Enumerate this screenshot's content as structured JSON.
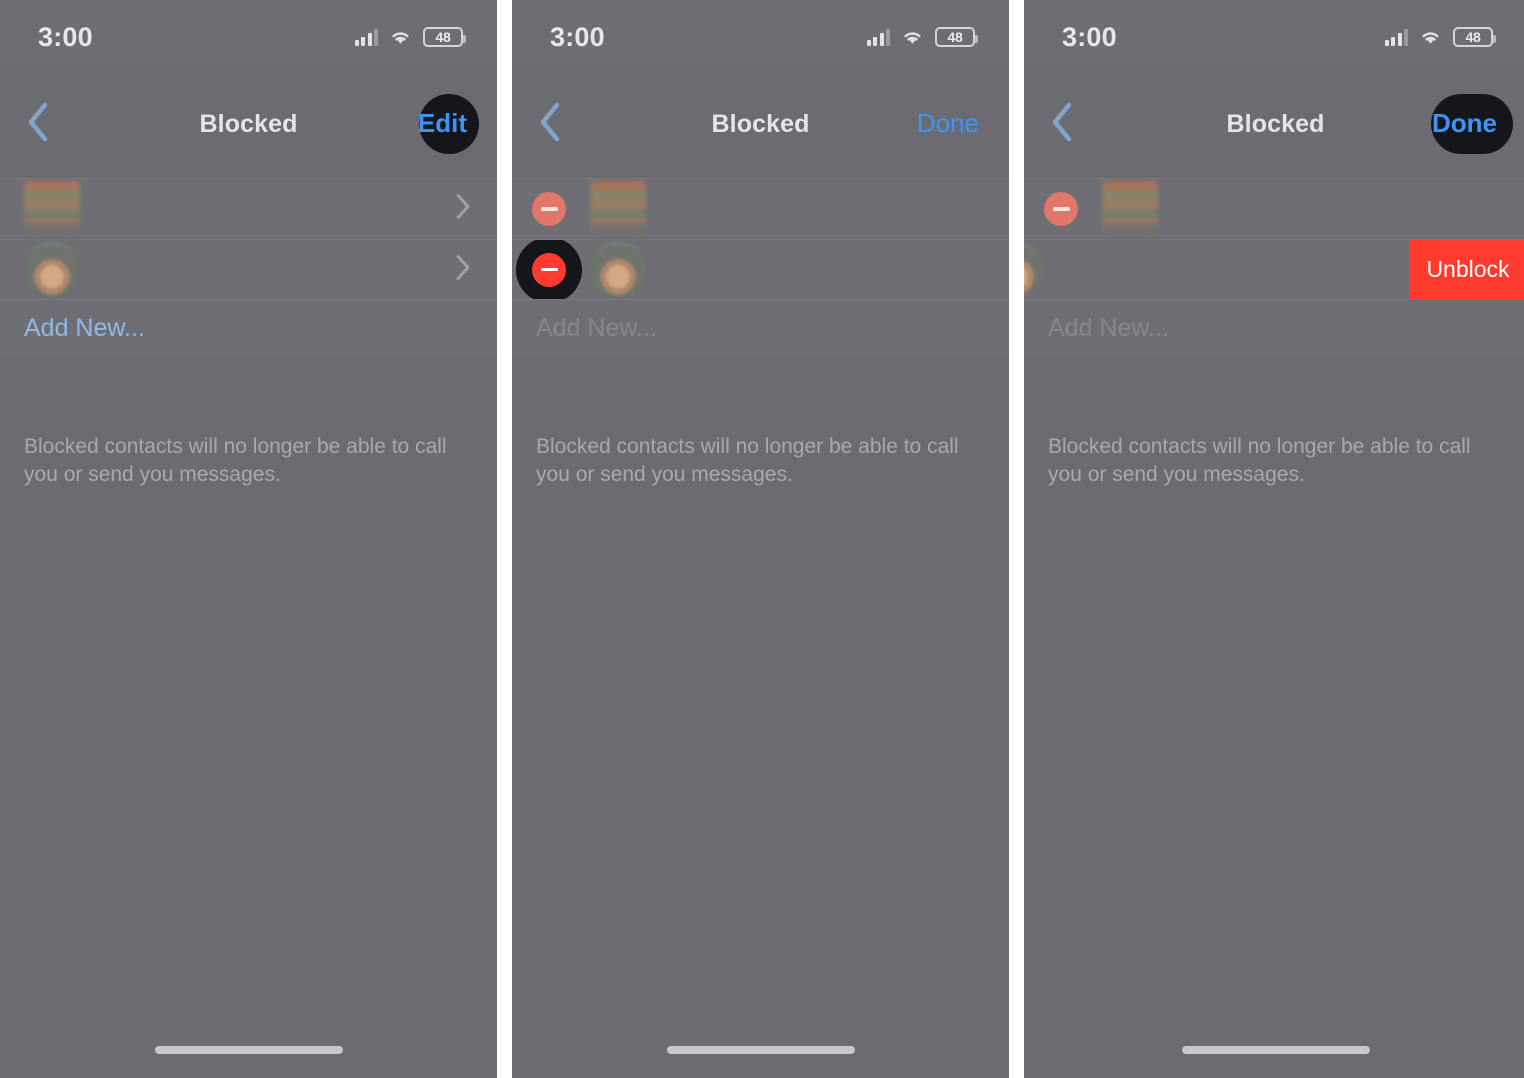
{
  "meta": {
    "os": "iOS",
    "screen_title": "Blocked",
    "panel_count": 3
  },
  "colors": {
    "background": "#6b6b71",
    "list_background": "#6e6e74",
    "accent_blue": "#3d96f5",
    "destructive_red": "#ff3b30",
    "highlight_dark": "#15151c",
    "primary_text": "#e5e5e7",
    "secondary_text": "#a8a8ae",
    "gap_white": "#ffffff"
  },
  "status_bar": {
    "time": "3:00",
    "cellular_icon": "cellular-signal-icon",
    "wifi_icon": "wifi-icon",
    "battery_icon": "battery-icon",
    "battery_level": "48"
  },
  "panels": [
    {
      "id": "panel-1",
      "state": "view",
      "nav": {
        "back_icon": "chevron-left-icon",
        "title": "Blocked",
        "action_label": "Edit",
        "action_name": "edit-button",
        "action_highlighted": true,
        "highlight_shape": "circle"
      },
      "rows": [
        {
          "avatar": "contact-avatar-1",
          "accessory": "chevron-right-icon",
          "name": "blocked-contact-row-1"
        },
        {
          "avatar": "contact-avatar-2",
          "accessory": "chevron-right-icon",
          "name": "blocked-contact-row-2"
        }
      ],
      "add_new_label": "Add New...",
      "add_new_dimmed": false,
      "footnote": "Blocked contacts will no longer be able to call you or send you messages.",
      "home_indicator": true
    },
    {
      "id": "panel-2",
      "state": "editing",
      "nav": {
        "back_icon": "chevron-left-icon",
        "title": "Blocked",
        "action_label": "Done",
        "action_name": "done-button",
        "action_highlighted": false,
        "highlight_shape": "none"
      },
      "rows": [
        {
          "avatar": "contact-avatar-1",
          "accessory": "minus-circle-icon",
          "minus_active": false,
          "minus_highlighted": false,
          "name": "blocked-contact-row-1"
        },
        {
          "avatar": "contact-avatar-2",
          "accessory": "minus-circle-icon",
          "minus_active": true,
          "minus_highlighted": true,
          "name": "blocked-contact-row-2"
        }
      ],
      "add_new_label": "Add New...",
      "add_new_dimmed": true,
      "footnote": "Blocked contacts will no longer be able to call you or send you messages.",
      "home_indicator": true
    },
    {
      "id": "panel-3",
      "state": "swiped-row-revealed",
      "nav": {
        "back_icon": "chevron-left-icon",
        "title": "Blocked",
        "action_label": "Done",
        "action_name": "done-button",
        "action_highlighted": true,
        "highlight_shape": "pill"
      },
      "rows": [
        {
          "avatar": "contact-avatar-1",
          "accessory": "minus-circle-icon",
          "minus_active": false,
          "minus_highlighted": false,
          "name": "blocked-contact-row-1"
        },
        {
          "avatar": "contact-avatar-2",
          "accessory": "unblock-button",
          "swiped": true,
          "swipe_action_label": "Unblock",
          "name": "blocked-contact-row-2"
        }
      ],
      "add_new_label": "Add New...",
      "add_new_dimmed": true,
      "footnote": "Blocked contacts will no longer be able to call you or send you messages.",
      "home_indicator": true
    }
  ]
}
